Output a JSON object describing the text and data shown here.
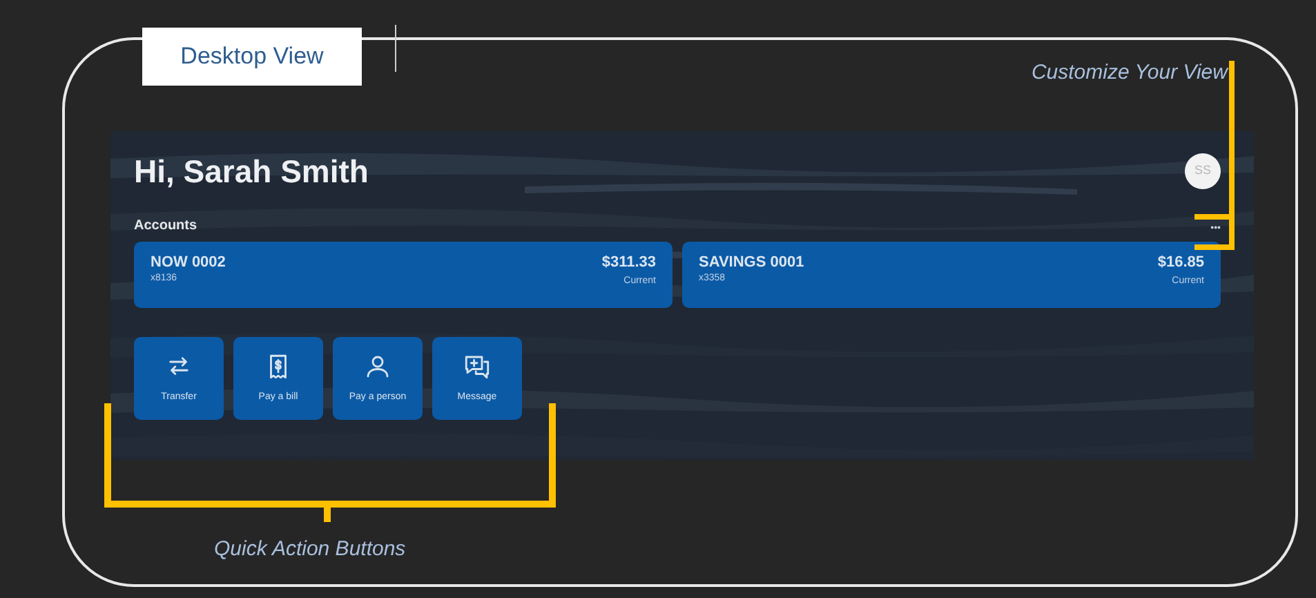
{
  "view_label": "Desktop View",
  "callouts": [
    {
      "label": "Customize Your View"
    },
    {
      "label": "Quick Action Buttons"
    }
  ],
  "app": {
    "greeting": "Hi, Sarah Smith",
    "avatar": "SS",
    "section": "Accounts",
    "more": "•••",
    "accounts": [
      {
        "name": "NOW 0002",
        "number": "x8136",
        "balance": "$311.33",
        "status": "Current"
      },
      {
        "name": "SAVINGS 0001",
        "number": "x3358",
        "balance": "$16.85",
        "status": "Current"
      }
    ],
    "quick_actions": [
      {
        "label": "Transfer",
        "kind": "transfer"
      },
      {
        "label": "Pay a bill",
        "kind": "bill"
      },
      {
        "label": "Pay a person",
        "kind": "person"
      },
      {
        "label": "Message",
        "kind": "message"
      }
    ]
  }
}
